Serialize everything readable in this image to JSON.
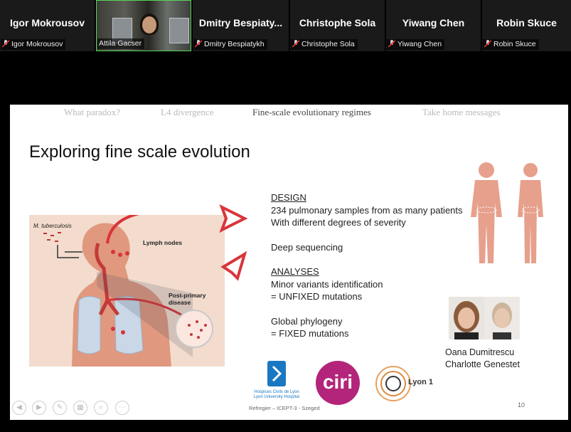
{
  "participants": [
    {
      "display_name": "Igor Mokrousov",
      "label": "Igor Mokrousov",
      "muted": true,
      "video": false
    },
    {
      "display_name": "",
      "label": "Attila Gacser",
      "muted": false,
      "video": true
    },
    {
      "display_name": "Dmitry  Bespiaty...",
      "label": "Dmitry Bespiatykh",
      "muted": true,
      "video": false
    },
    {
      "display_name": "Christophe Sola",
      "label": "Christophe Sola",
      "muted": true,
      "video": false
    },
    {
      "display_name": "Yiwang Chen",
      "label": "Yiwang Chen",
      "muted": true,
      "video": false
    },
    {
      "display_name": "Robin Skuce",
      "label": "Robin Skuce",
      "muted": true,
      "video": false
    }
  ],
  "slide": {
    "nav": [
      "What paradox?",
      "L4 divergence",
      "Fine-scale evolutionary regimes",
      "Take home messages"
    ],
    "nav_current": 2,
    "title": "Exploring fine scale evolution",
    "diagram_labels": {
      "organism": "M. tuberculosis",
      "lymph": "Lymph nodes",
      "post_primary_1": "Post-primary",
      "post_primary_2": "disease"
    },
    "design_heading": "DESIGN",
    "design_lines": [
      "234 pulmonary samples from as many patients",
      "With different degrees of severity"
    ],
    "deep_seq": "Deep sequencing",
    "analyses_heading": "ANALYSES",
    "analyses_lines": [
      "Minor variants identification",
      "=  UNFIXED mutations"
    ],
    "phylogeny_lines": [
      "Global phylogeny",
      "= FIXED mutations"
    ],
    "people": [
      "Oana Dumitrescu",
      "Charlotte Genestet"
    ],
    "logos": {
      "hcl_1": "Hospices Civils de Lyon",
      "hcl_2": "Lyon University Hospital",
      "ciri": "ciri",
      "lyon1": "Lyon 1"
    },
    "footer": "Refregier – ICEPT-3 - Szeged",
    "page_number": "10"
  },
  "colors": {
    "arrow": "#d9343a",
    "muted_icon": "#e03030",
    "active_border": "#59d659",
    "ciri": "#b3257a",
    "hcl": "#1a78c2"
  }
}
